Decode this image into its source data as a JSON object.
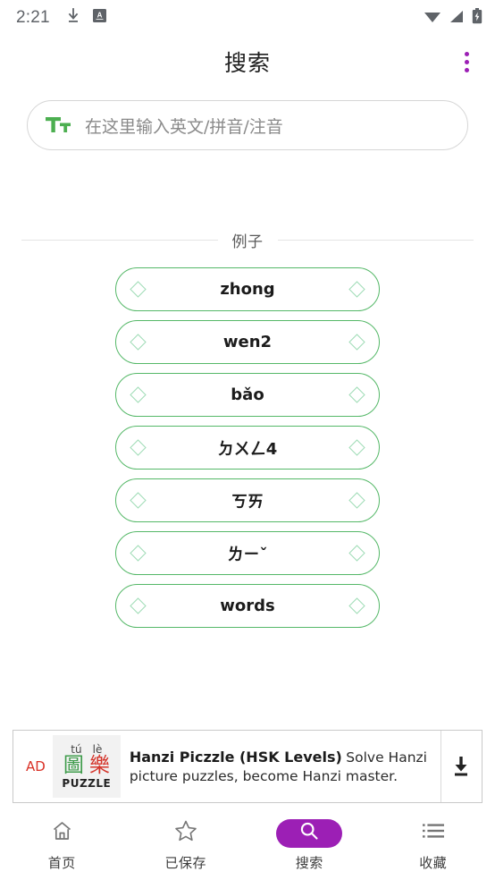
{
  "status_bar": {
    "clock": "2:21",
    "left_icons": [
      "download-icon",
      "app-badge-icon"
    ],
    "right_icons": [
      "wifi-icon",
      "signal-icon",
      "battery-charging-icon"
    ],
    "icon_color": "#5f6368"
  },
  "header": {
    "title": "搜索",
    "overflow_icon": "more-vertical-icon",
    "accent_color": "#9c1fb5"
  },
  "search": {
    "icon": "text-format-icon",
    "icon_color": "#4caf50",
    "value": "",
    "placeholder": "在这里输入英文/拼音/注音"
  },
  "examples": {
    "section_label": "例子",
    "border_color": "#55b868",
    "diamond_color": "#9fdcb6",
    "items": [
      {
        "label": "zhong"
      },
      {
        "label": "wen2"
      },
      {
        "label": "bǎo"
      },
      {
        "label": "ㄉㄨㄥ4"
      },
      {
        "label": "ㄎㄞ"
      },
      {
        "label": "ㄌㄧˇ"
      },
      {
        "label": "words"
      }
    ]
  },
  "ad": {
    "tag": "AD",
    "tag_color": "#d93025",
    "icon": {
      "pinyin_left": "tú",
      "pinyin_right": "lè",
      "hanzi_left": "圖",
      "hanzi_right": "樂",
      "word": "PUZZLE"
    },
    "title": "Hanzi Piczzle (HSK Levels)",
    "description": "Solve Hanzi picture puzzles, become Hanzi master.",
    "action_icon": "download-icon"
  },
  "bottom_nav": {
    "active_color": "#9c1fb5",
    "items": [
      {
        "label": "首页",
        "icon": "home-icon",
        "active": false
      },
      {
        "label": "已保存",
        "icon": "star-icon",
        "active": false
      },
      {
        "label": "搜索",
        "icon": "search-icon",
        "active": true
      },
      {
        "label": "收藏",
        "icon": "list-icon",
        "active": false
      }
    ]
  }
}
